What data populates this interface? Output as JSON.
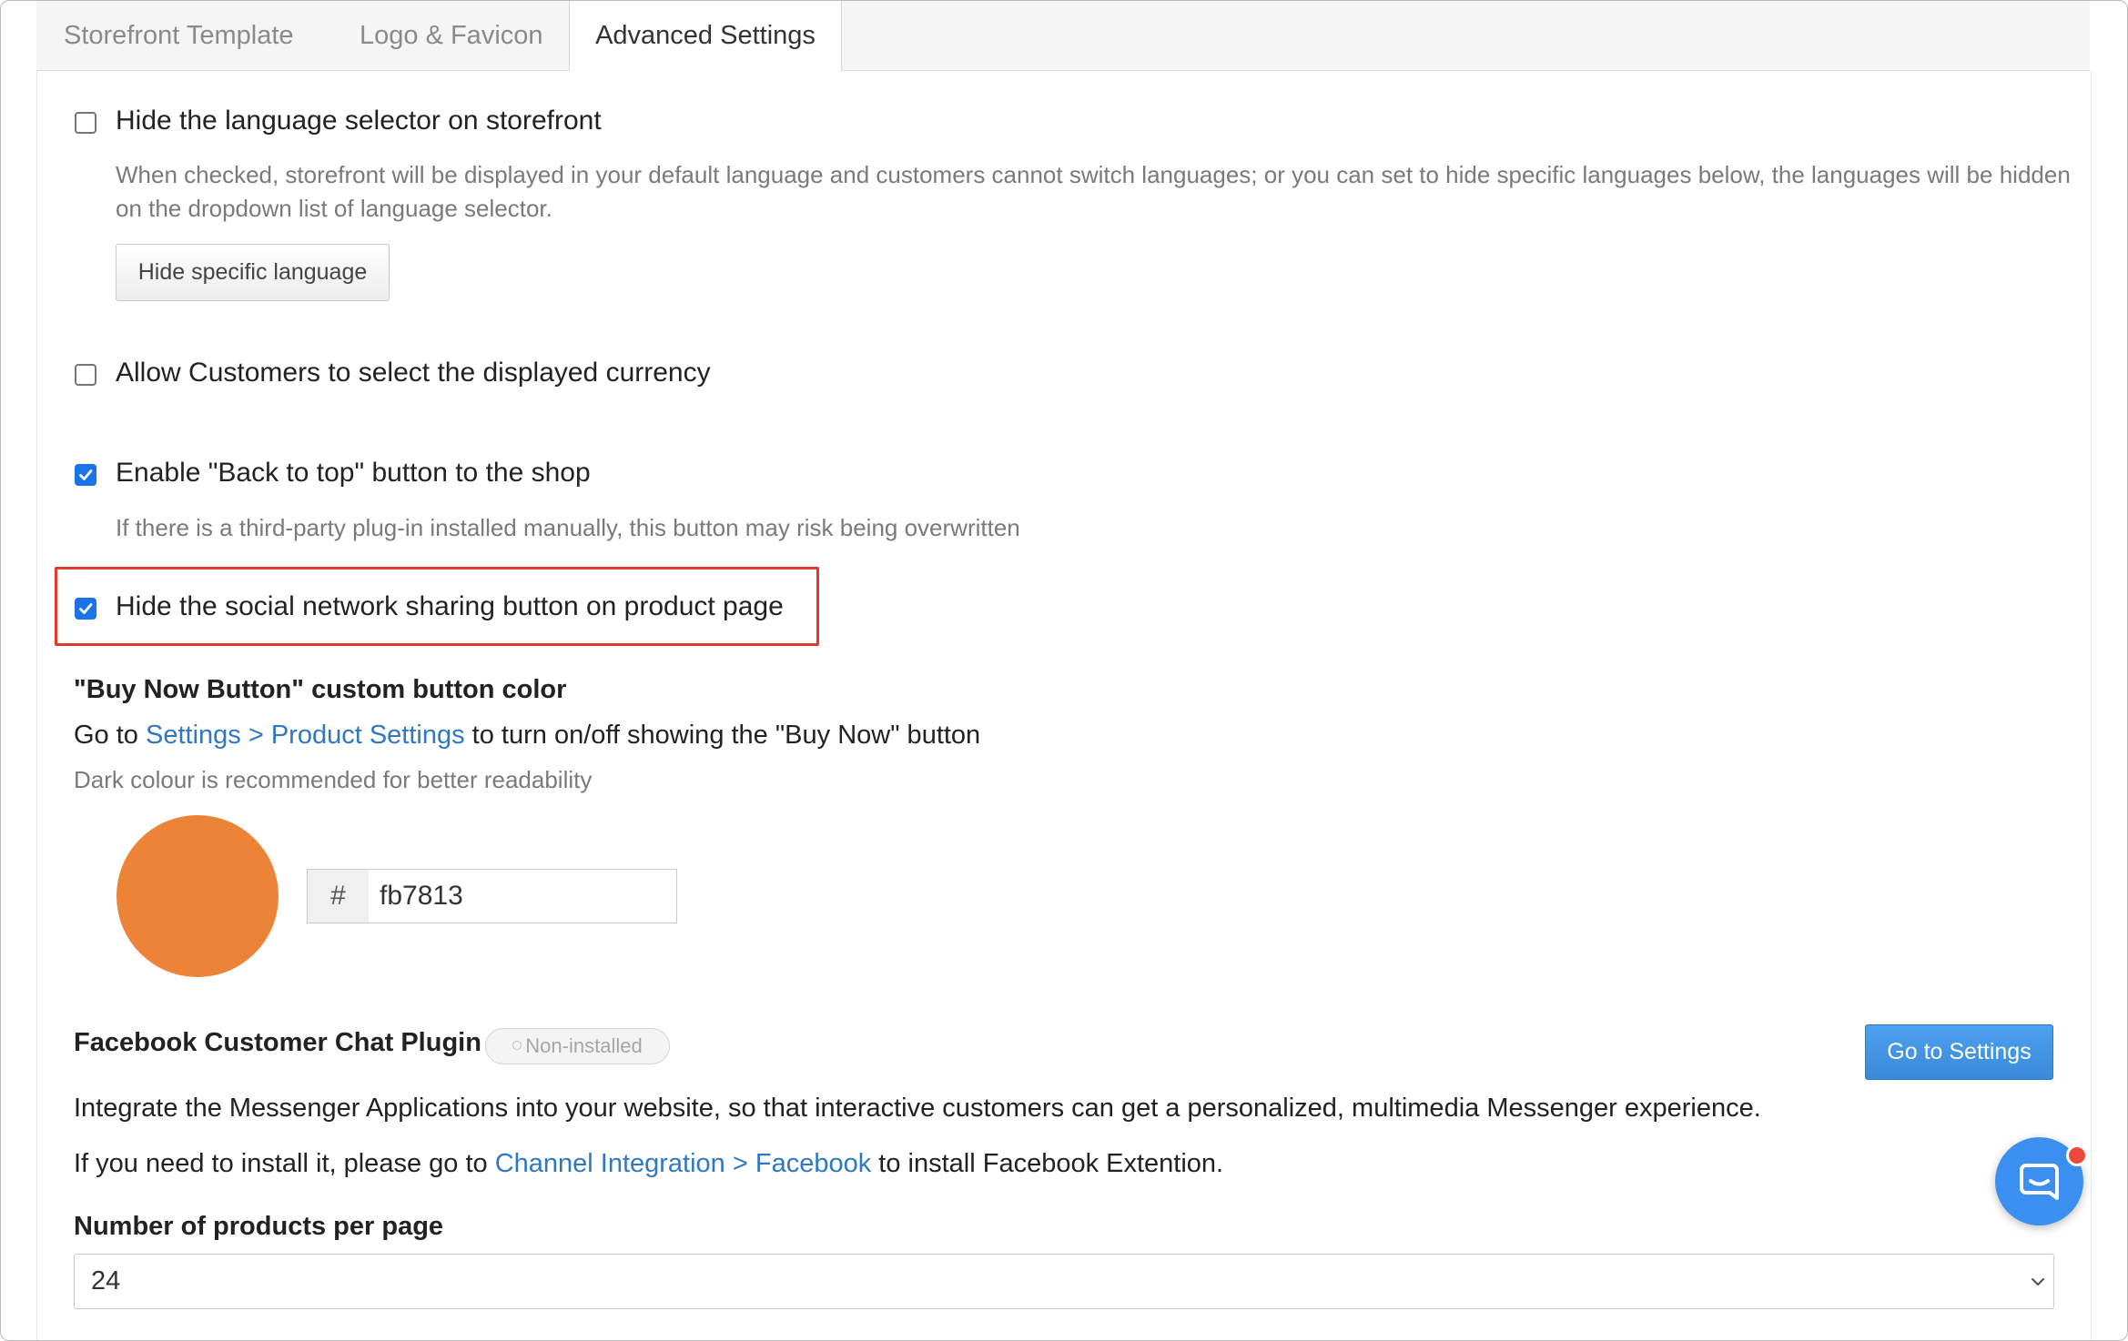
{
  "tabs": [
    {
      "label": "Storefront Template",
      "active": false
    },
    {
      "label": "Logo & Favicon",
      "active": false
    },
    {
      "label": "Advanced Settings",
      "active": true
    }
  ],
  "options": {
    "hide_language": {
      "checked": false,
      "label": "Hide the language selector on storefront",
      "help": "When checked, storefront will be displayed in your default language and customers cannot switch languages; or you can set to hide specific languages below, the languages will be hidden on the dropdown list of language selector.",
      "button_label": "Hide specific language"
    },
    "currency": {
      "checked": false,
      "label": "Allow Customers to select the displayed currency"
    },
    "back_to_top": {
      "checked": true,
      "label": "Enable \"Back to top\" button to the shop",
      "help": "If there is a third-party plug-in installed manually, this button may risk being overwritten"
    },
    "hide_social": {
      "checked": true,
      "label": "Hide the social network sharing button on product page"
    }
  },
  "buy_now": {
    "title": "\"Buy Now Button\" custom button color",
    "desc_prefix": "Go to ",
    "desc_link": "Settings > Product Settings",
    "desc_suffix": " to turn on/off showing the \"Buy Now\" button",
    "hint": "Dark colour is recommended for better readability",
    "hash": "#",
    "color_value": "fb7813",
    "swatch_color": "#ed8336"
  },
  "facebook": {
    "title": "Facebook Customer Chat Plugin",
    "status": "Non-installed",
    "button_label": "Go to Settings",
    "desc": "Integrate the Messenger Applications into your website, so that interactive customers can get a personalized, multimedia Messenger experience.",
    "install_prefix": "If you need to install it, please go to ",
    "install_link": "Channel Integration > Facebook",
    "install_suffix": " to install Facebook Extention."
  },
  "per_page": {
    "label": "Number of products per page",
    "value": "24"
  },
  "colors": {
    "accent": "#1a73e8",
    "link": "#2f78c4",
    "primary_button": "#3a8ad9",
    "highlight_box": "#e0392e",
    "chat_launcher": "#3b8ff0",
    "notification_dot": "#ee4a3c"
  },
  "icons": {
    "checkbox_checked": "checkmark-icon",
    "select_chevron": "chevron-down-icon",
    "chat_launcher": "chat-bubble-icon"
  }
}
